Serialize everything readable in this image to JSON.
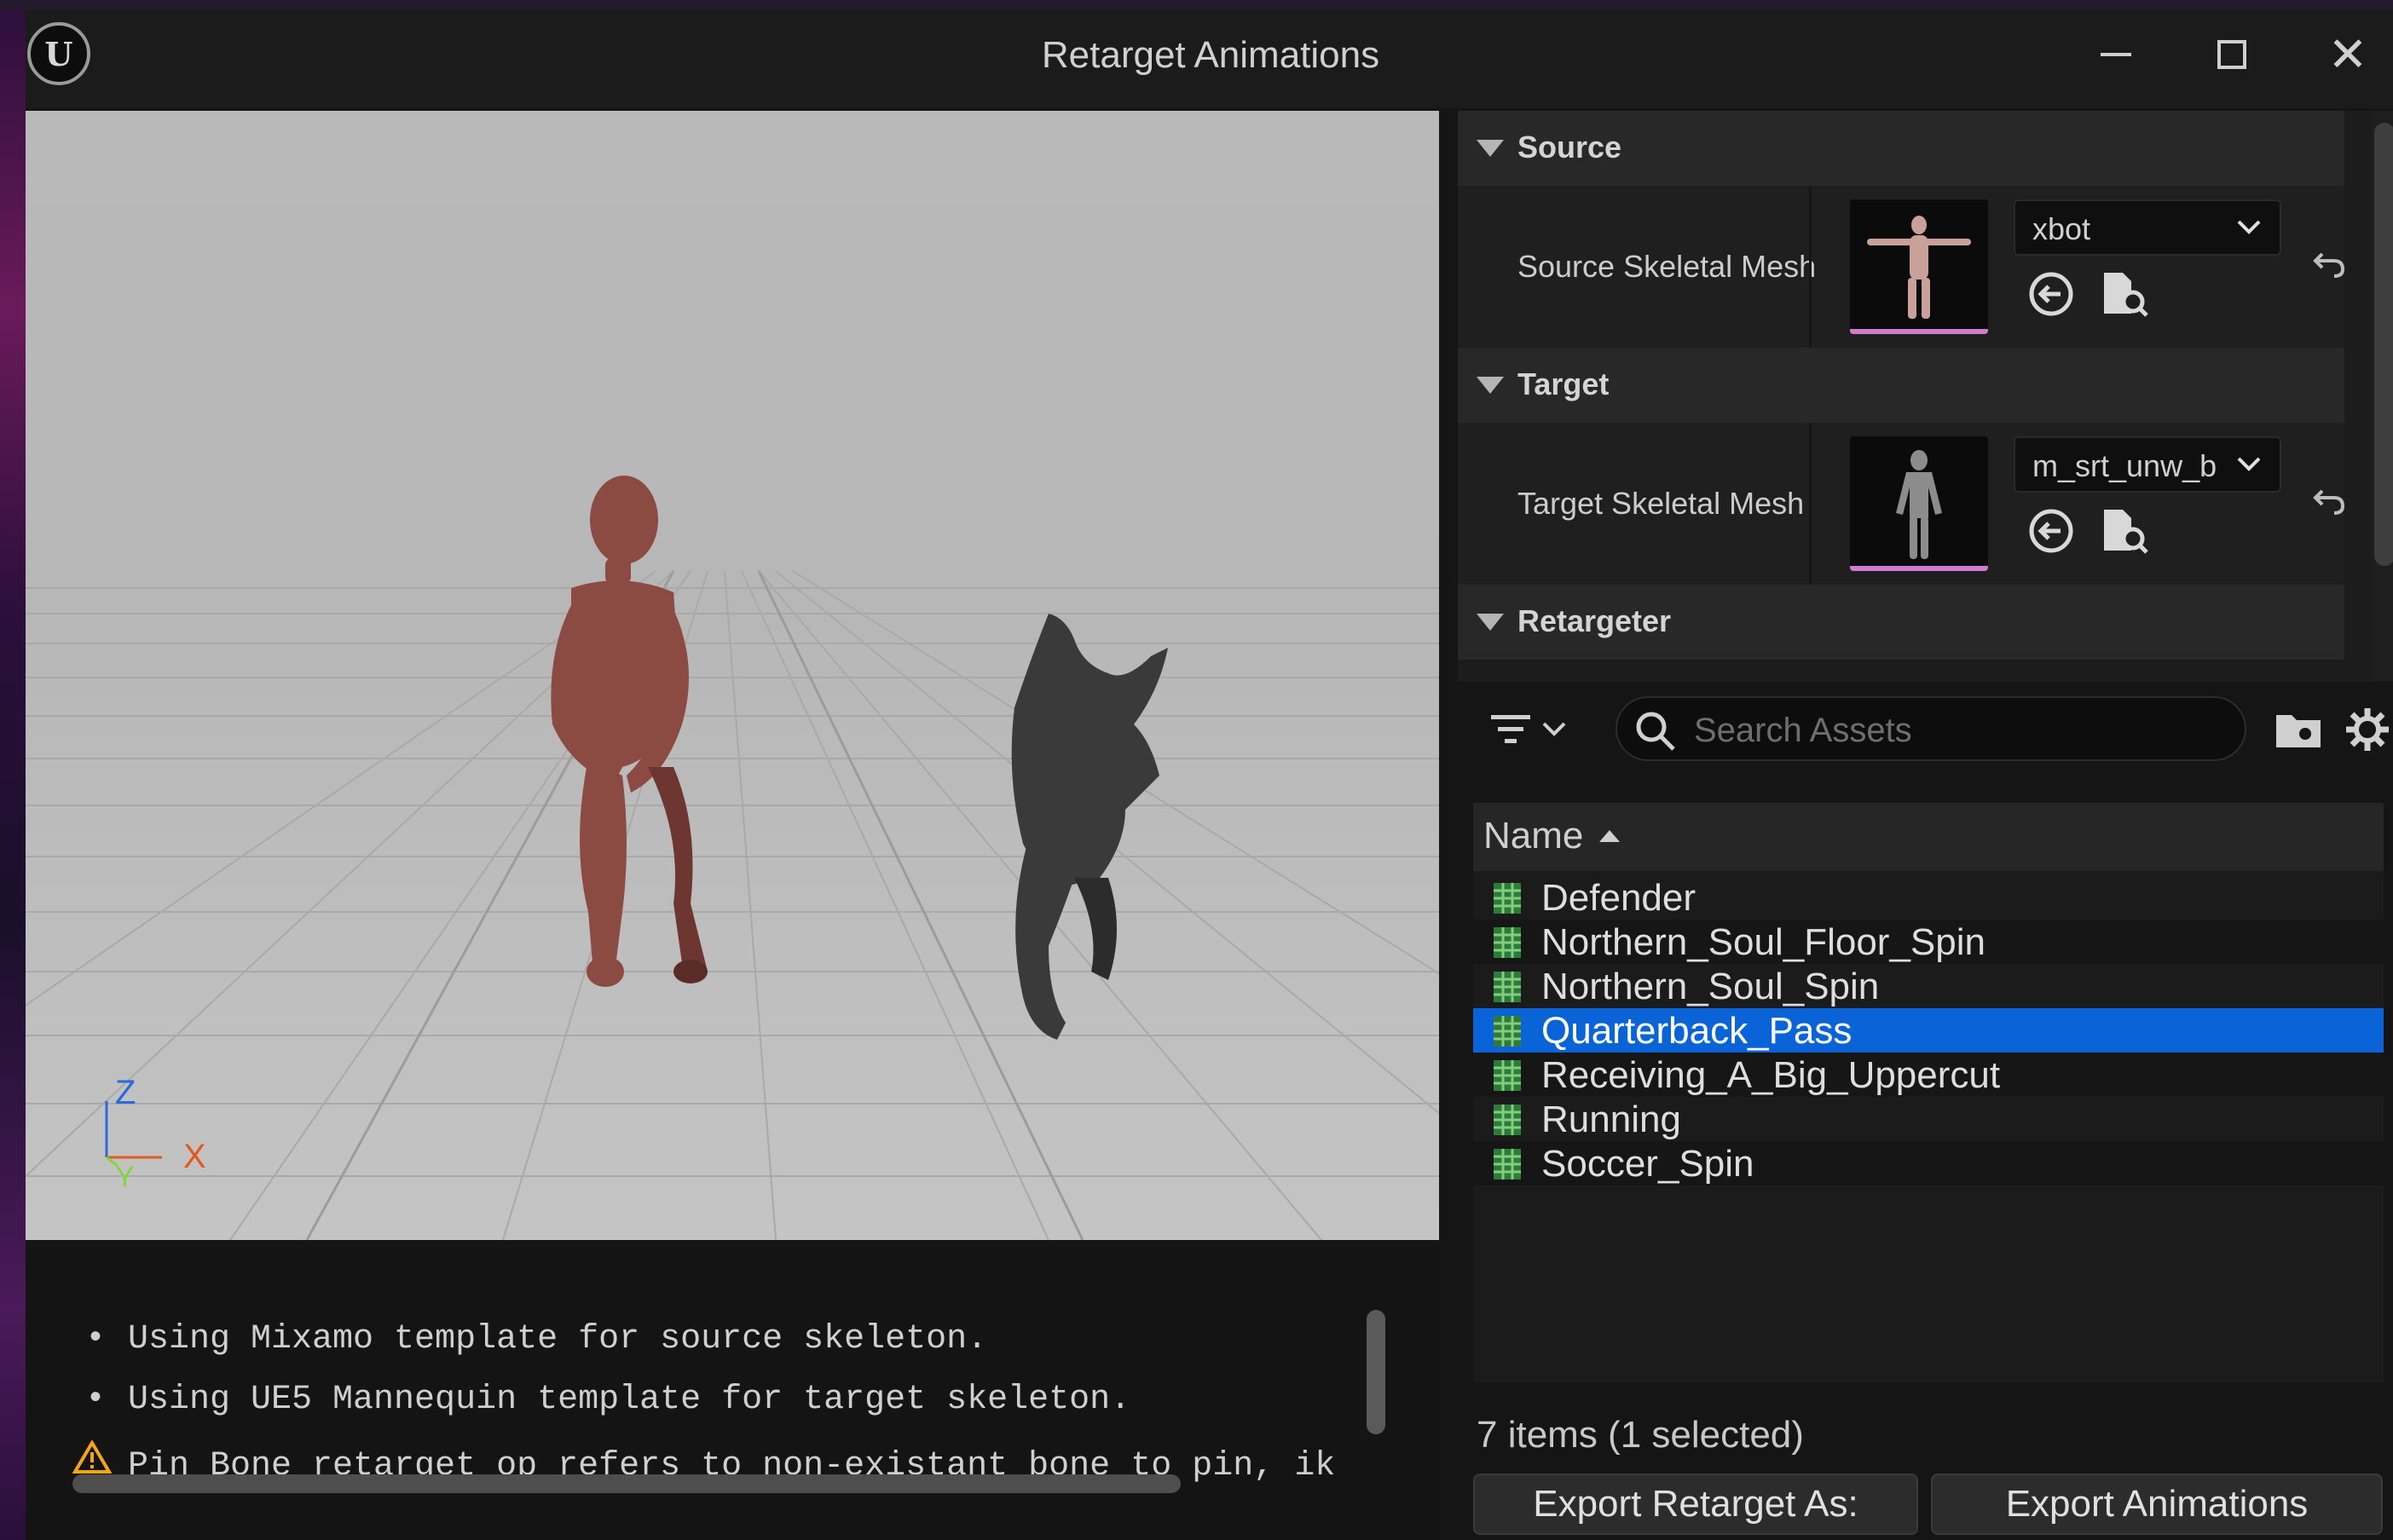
{
  "window": {
    "title": "Retarget Animations"
  },
  "details": {
    "source": {
      "header": "Source",
      "property_label": "Source Skeletal Mesh",
      "selected_mesh": "xbot"
    },
    "target": {
      "header": "Target",
      "property_label": "Target Skeletal Mesh",
      "selected_mesh": "m_srt_unw_b"
    },
    "retargeter": {
      "header": "Retargeter"
    }
  },
  "viewport": {
    "axis_labels": {
      "z": "Z",
      "x": "X",
      "y": "Y"
    }
  },
  "log": {
    "lines": [
      {
        "kind": "info",
        "text": "Using Mixamo template for source skeleton."
      },
      {
        "kind": "info",
        "text": "Using UE5 Mannequin template for target skeleton."
      },
      {
        "kind": "warning",
        "text": "Pin Bone retarget op refers to non-existant bone to pin, ik"
      }
    ]
  },
  "asset_picker": {
    "search_placeholder": "Search Assets",
    "column_header": "Name",
    "items": [
      "Defender",
      "Northern_Soul_Floor_Spin",
      "Northern_Soul_Spin",
      "Quarterback_Pass",
      "Receiving_A_Big_Uppercut",
      "Running",
      "Soccer_Spin"
    ],
    "selected_item": "Quarterback_Pass",
    "status": "7 items (1 selected)"
  },
  "buttons": {
    "export_retarget_assets": "Export Retarget As:",
    "export_animations": "Export Animations"
  },
  "colors": {
    "selection": "#0a64d8",
    "source_character": "#8b4a42",
    "target_character": "#3a3a3a",
    "axis_x": "#e05a1e",
    "axis_y": "#7dd83a",
    "axis_z": "#2a6ae0"
  }
}
